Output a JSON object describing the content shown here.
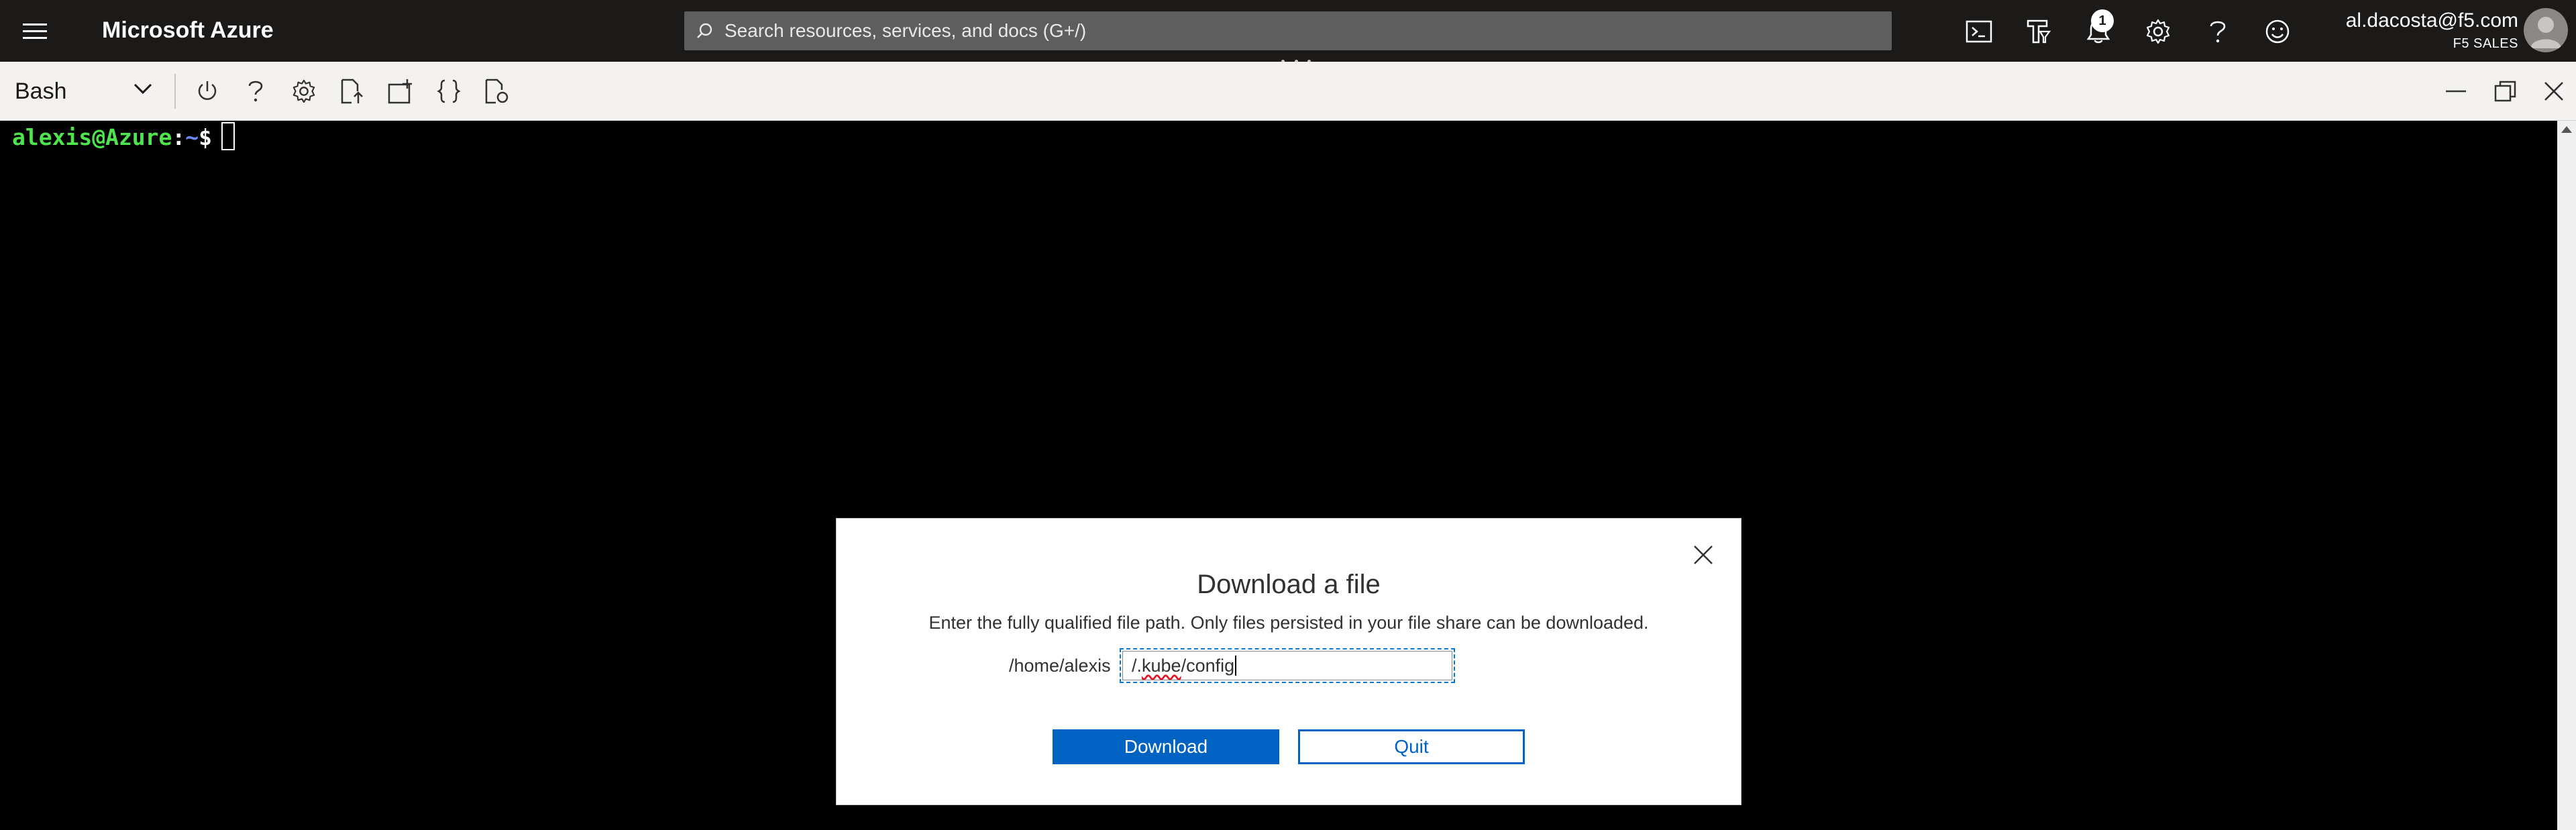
{
  "topbar": {
    "brand": "Microsoft Azure",
    "search_placeholder": "Search resources, services, and docs (G+/)",
    "notifications_count": "1",
    "account_email": "al.dacosta@f5.com",
    "account_tenant": "F5 SALES",
    "icons": [
      "cloud-shell-icon",
      "directory-filter-icon",
      "notifications-icon",
      "settings-icon",
      "help-icon",
      "feedback-icon"
    ]
  },
  "shell": {
    "environment": "Bash",
    "toolbar_icons": [
      "restart-icon",
      "help-icon",
      "settings-icon",
      "upload-download-icon",
      "open-new-session-icon",
      "editor-braces-icon",
      "web-preview-icon"
    ],
    "window_controls": [
      "minimize-icon",
      "maximize-icon",
      "close-icon"
    ]
  },
  "terminal": {
    "user_host": "alexis@Azure",
    "separator": ":",
    "path": "~",
    "symbol": "$"
  },
  "dialog": {
    "title": "Download a file",
    "description": "Enter the fully qualified file path. Only files persisted in your file share can be downloaded.",
    "path_prefix": "/home/alexis",
    "input_part1": "/.",
    "input_misspelled": "kube",
    "input_part2": "/config",
    "download_label": "Download",
    "quit_label": "Quit"
  },
  "colors": {
    "topbar_bg": "#1b1a19",
    "accent": "#0062c3",
    "prompt_user": "#4ee44e",
    "prompt_path": "#6a8cff"
  }
}
